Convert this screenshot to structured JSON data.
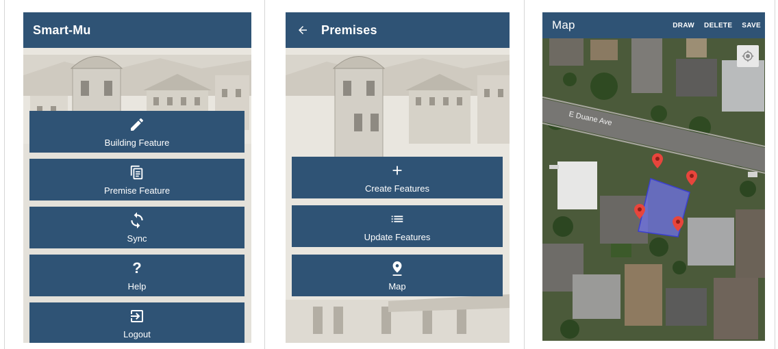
{
  "screen1": {
    "title": "Smart-Mu",
    "menu": [
      {
        "label": "Building Feature",
        "icon": "pencil-icon"
      },
      {
        "label": "Premise Feature",
        "icon": "copy-document-icon"
      },
      {
        "label": "Sync",
        "icon": "sync-icon"
      },
      {
        "label": "Help",
        "icon": "help-icon"
      },
      {
        "label": "Logout",
        "icon": "logout-icon"
      }
    ]
  },
  "screen2": {
    "title": "Premises",
    "back_icon": "arrow-left-icon",
    "menu": [
      {
        "label": "Create Features",
        "icon": "plus-icon"
      },
      {
        "label": "Update Features",
        "icon": "list-icon"
      },
      {
        "label": "Map",
        "icon": "map-pin-icon"
      }
    ]
  },
  "screen3": {
    "title": "Map",
    "actions": [
      "DRAW",
      "DELETE",
      "SAVE"
    ],
    "street_label": "E Duane Ave",
    "locate_icon": "my-location-icon",
    "marker_icon": "map-marker-icon"
  },
  "colors": {
    "appbar": "#2f5375",
    "button": "#2f5375",
    "marker": "#e8453c",
    "polygon_fill": "#6f73e8",
    "map_base": "#4d5a3c"
  }
}
